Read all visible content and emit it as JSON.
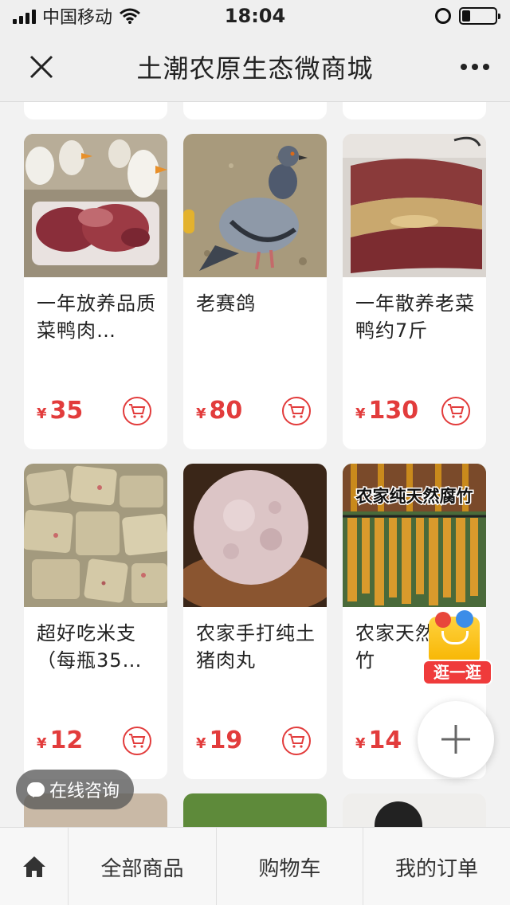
{
  "status_bar": {
    "carrier": "中国移动",
    "time": "18:04",
    "battery_level": 0.25
  },
  "nav": {
    "title": "土潮农原生态微商城"
  },
  "products": [
    {
      "name": "一年放养品质菜鸭肉…",
      "price": "35",
      "image": "ducks-and-meat"
    },
    {
      "name": "老赛鸽",
      "price": "80",
      "image": "pigeon"
    },
    {
      "name": "一年散养老菜鸭约7斤",
      "price": "130",
      "image": "cured-duck"
    },
    {
      "name": "超好吃米支（每瓶35…",
      "price": "12",
      "image": "rice-crisps"
    },
    {
      "name": "农家手打纯土猪肉丸",
      "price": "19",
      "image": "pork-ball"
    },
    {
      "name": "农家天然泉腐竹",
      "price": "14",
      "image": "tofu-skin",
      "image_caption": "农家纯天然腐竹"
    }
  ],
  "currency_symbol": "¥",
  "floating": {
    "chat_label": "在线咨询",
    "promo_label": "逛一逛"
  },
  "tabbar": {
    "items": [
      "全部商品",
      "购物车",
      "我的订单"
    ]
  },
  "colors": {
    "price_red": "#e23c3c",
    "background": "#f2f2f2",
    "bar_gray": "#efefef"
  }
}
